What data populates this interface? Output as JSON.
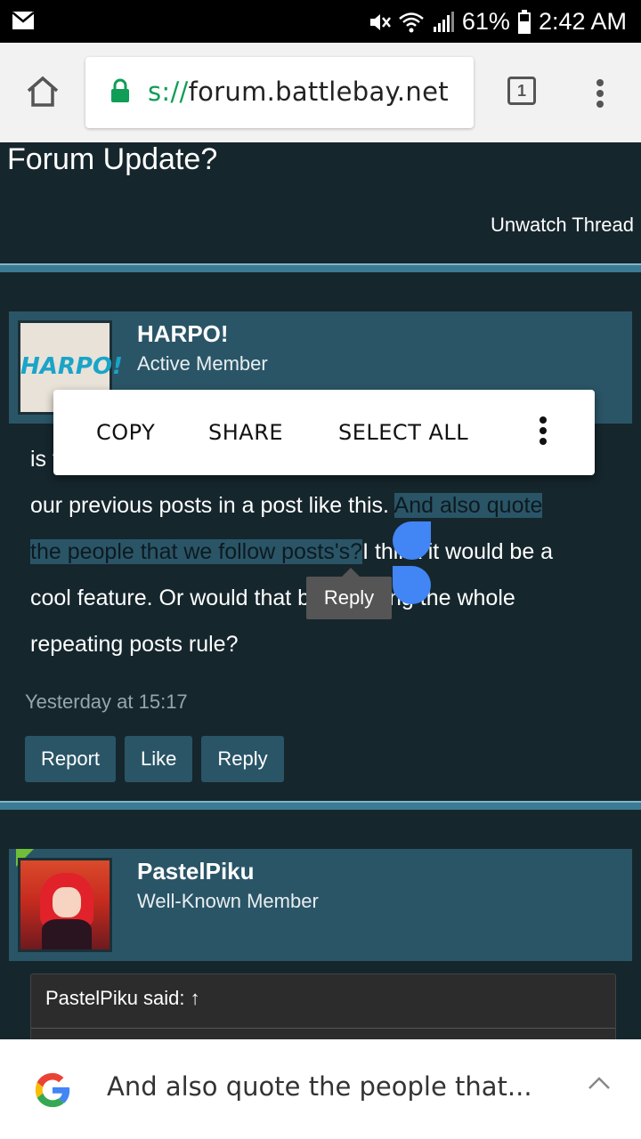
{
  "status_bar": {
    "battery": "61%",
    "time": "2:42 AM",
    "icons": [
      "mail-icon",
      "mute-icon",
      "wifi-icon",
      "signal-icon",
      "battery-icon"
    ]
  },
  "browser": {
    "url_scheme": "s://",
    "url_host": "forum.battlebay.net",
    "tab_count": "1",
    "icons": [
      "home-icon",
      "lock-icon",
      "tabs-icon",
      "overflow-menu-icon"
    ]
  },
  "thread": {
    "title": "Forum Update?",
    "unwatch_label": "Unwatch Thread"
  },
  "posts": [
    {
      "username": "HARPO!",
      "role": "Active Member",
      "avatar_text": "HARPO!",
      "text_line1_start": "is t",
      "text_line2_plain": "our previous posts in a post like this. ",
      "text_line2_selected": "And also quote",
      "text_line3_selected": "the people that we follow posts's?",
      "text_line3_plain": "I think it would be a",
      "text_line4": "cool feature. Or would that be breaking the whole",
      "text_line5": "repeating posts rule?",
      "timestamp": "Yesterday at 15:17",
      "actions": [
        "Report",
        "Like",
        "Reply"
      ]
    },
    {
      "username": "PastelPiku",
      "role": "Well-Known Member",
      "quote_header": "PastelPiku said: ↑"
    }
  ],
  "context_menu": {
    "items": [
      "COPY",
      "SHARE",
      "SELECT ALL"
    ],
    "more_icon": "overflow-menu-icon"
  },
  "selection_tooltip": "Reply",
  "search_bar": {
    "query_preview": "And also quote the people that...",
    "icons": [
      "google-logo",
      "chevron-up-icon"
    ]
  },
  "colors": {
    "page_bg": "#16262d",
    "userbar_bg": "#2a5567",
    "divider": "#3c7b94",
    "handle": "#4285f4"
  }
}
